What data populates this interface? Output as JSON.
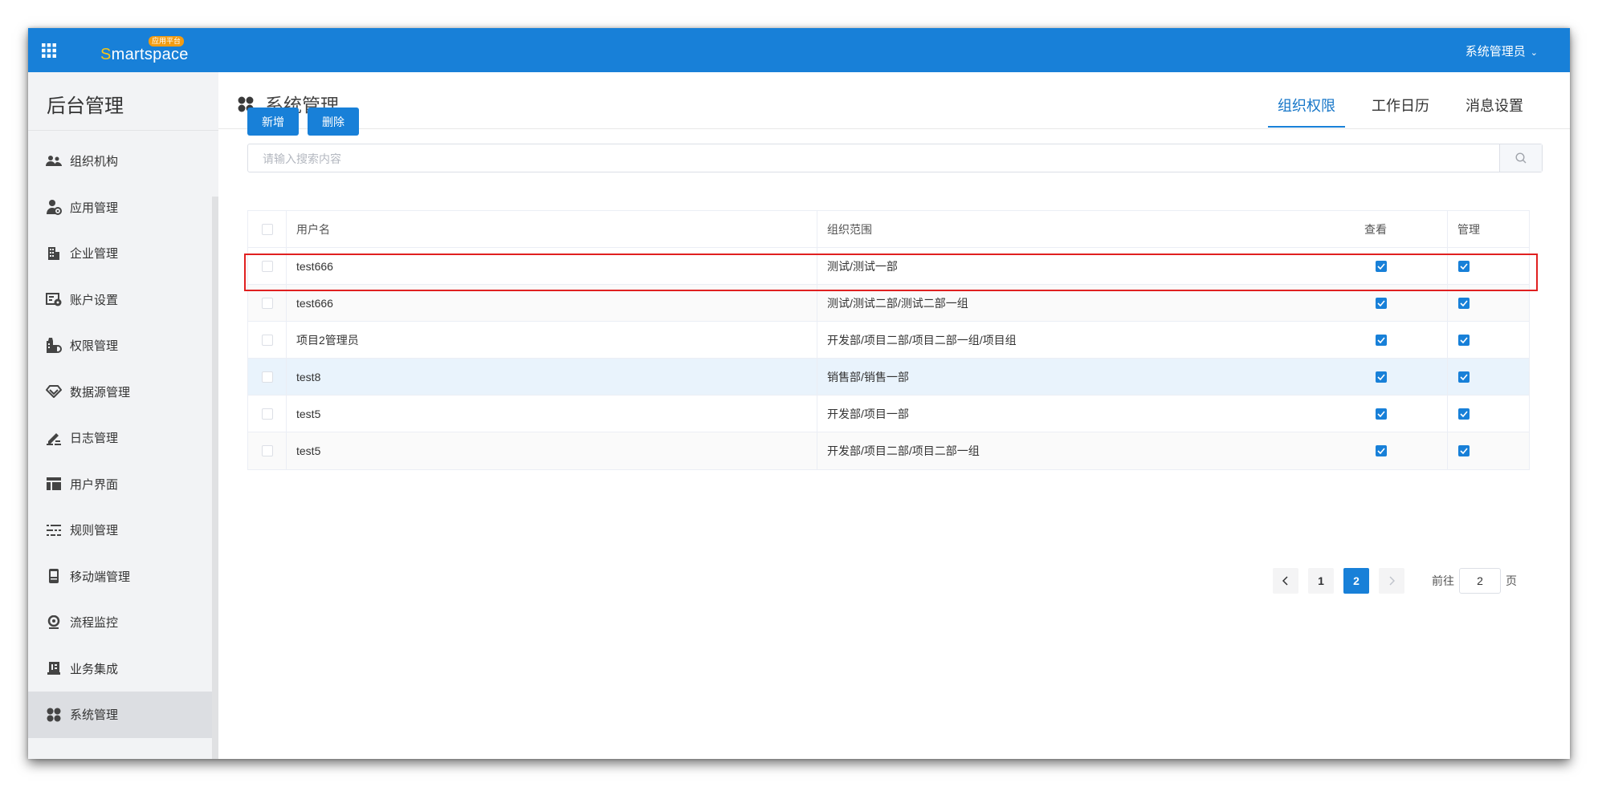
{
  "app": {
    "logo_text_first": "S",
    "logo_text_rest": "martspace",
    "logo_badge": "应用平台",
    "user": "系统管理员"
  },
  "sidebar": {
    "title": "后台管理",
    "items": [
      {
        "label": "组织机构",
        "icon": "org-icon"
      },
      {
        "label": "应用管理",
        "icon": "app-manage-icon"
      },
      {
        "label": "企业管理",
        "icon": "building-icon"
      },
      {
        "label": "账户设置",
        "icon": "account-settings-icon"
      },
      {
        "label": "权限管理",
        "icon": "permission-icon"
      },
      {
        "label": "数据源管理",
        "icon": "datasource-icon"
      },
      {
        "label": "日志管理",
        "icon": "log-icon"
      },
      {
        "label": "用户界面",
        "icon": "layout-icon"
      },
      {
        "label": "规则管理",
        "icon": "rules-icon"
      },
      {
        "label": "移动端管理",
        "icon": "mobile-icon"
      },
      {
        "label": "流程监控",
        "icon": "monitor-icon"
      },
      {
        "label": "业务集成",
        "icon": "integration-icon"
      },
      {
        "label": "系统管理",
        "icon": "system-icon",
        "active": true
      }
    ]
  },
  "header": {
    "title": "系统管理",
    "tabs": [
      {
        "label": "组织权限",
        "active": true
      },
      {
        "label": "工作日历"
      },
      {
        "label": "消息设置"
      }
    ]
  },
  "toolbar": {
    "add_label": "新增",
    "delete_label": "删除"
  },
  "search": {
    "placeholder": "请输入搜索内容",
    "value": ""
  },
  "table": {
    "columns": [
      "用户名",
      "组织范围",
      "查看",
      "管理"
    ],
    "rows": [
      {
        "user": "test666",
        "org": "测试/测试一部",
        "view": true,
        "manage": true
      },
      {
        "user": "test666",
        "org": "测试/测试二部/测试二部一组",
        "view": true,
        "manage": true
      },
      {
        "user": "项目2管理员",
        "org": "开发部/项目二部/项目二部一组/项目组",
        "view": true,
        "manage": true
      },
      {
        "user": "test8",
        "org": "销售部/销售一部",
        "view": true,
        "manage": true
      },
      {
        "user": "test5",
        "org": "开发部/项目一部",
        "view": true,
        "manage": true
      },
      {
        "user": "test5",
        "org": "开发部/项目二部/项目二部一组",
        "view": true,
        "manage": true
      }
    ]
  },
  "pagination": {
    "pages": [
      "1",
      "2"
    ],
    "current": "2",
    "goto_label": "前往",
    "goto_value": "2",
    "goto_suffix": "页"
  },
  "colors": {
    "primary": "#1880d8",
    "sidebar_bg": "#f2f3f5",
    "highlight": "#e02020"
  }
}
